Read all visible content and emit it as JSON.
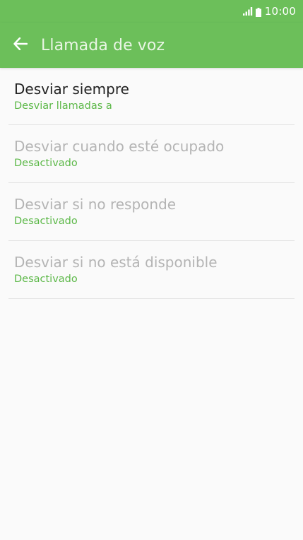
{
  "status_bar": {
    "time": "10:00",
    "signal_icon": "signal-icon",
    "battery_icon": "battery-icon"
  },
  "app_bar": {
    "title": "Llamada de voz",
    "back_icon": "arrow-left-icon"
  },
  "colors": {
    "accent": "#6cbf5a",
    "subtitle_green": "#5cb848",
    "background": "#fafafa",
    "title_enabled": "#222222",
    "title_disabled": "#b4b4b4"
  },
  "items": [
    {
      "title": "Desviar siempre",
      "subtitle": "Desviar llamadas a",
      "enabled": true
    },
    {
      "title": "Desviar cuando esté ocupado",
      "subtitle": "Desactivado",
      "enabled": false
    },
    {
      "title": "Desviar si no responde",
      "subtitle": "Desactivado",
      "enabled": false
    },
    {
      "title": "Desviar si no está disponible",
      "subtitle": "Desactivado",
      "enabled": false
    }
  ]
}
